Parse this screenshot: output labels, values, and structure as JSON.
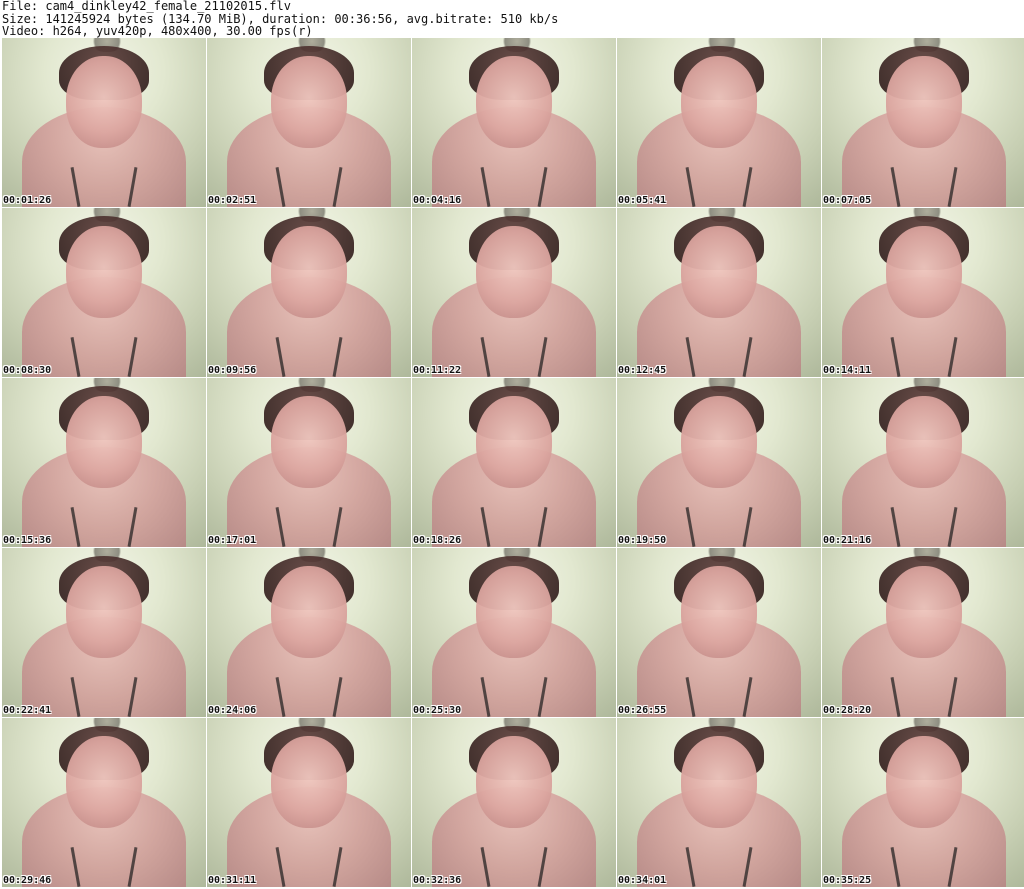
{
  "header": {
    "line1": "File: cam4_dinkley42_female_21102015.flv",
    "line2": "Size: 141245924 bytes (134.70 MiB), duration: 00:36:56, avg.bitrate: 510 kb/s",
    "line3": "Video: h264, yuv420p, 480x400, 30.00 fps(r)"
  },
  "thumbnails": [
    {
      "timestamp": "00:01:26"
    },
    {
      "timestamp": "00:02:51"
    },
    {
      "timestamp": "00:04:16"
    },
    {
      "timestamp": "00:05:41"
    },
    {
      "timestamp": "00:07:05"
    },
    {
      "timestamp": "00:08:30"
    },
    {
      "timestamp": "00:09:56"
    },
    {
      "timestamp": "00:11:22"
    },
    {
      "timestamp": "00:12:45"
    },
    {
      "timestamp": "00:14:11"
    },
    {
      "timestamp": "00:15:36"
    },
    {
      "timestamp": "00:17:01"
    },
    {
      "timestamp": "00:18:26"
    },
    {
      "timestamp": "00:19:50"
    },
    {
      "timestamp": "00:21:16"
    },
    {
      "timestamp": "00:22:41"
    },
    {
      "timestamp": "00:24:06"
    },
    {
      "timestamp": "00:25:30"
    },
    {
      "timestamp": "00:26:55"
    },
    {
      "timestamp": "00:28:20"
    },
    {
      "timestamp": "00:29:46"
    },
    {
      "timestamp": "00:31:11"
    },
    {
      "timestamp": "00:32:36"
    },
    {
      "timestamp": "00:34:01"
    },
    {
      "timestamp": "00:35:25"
    }
  ]
}
